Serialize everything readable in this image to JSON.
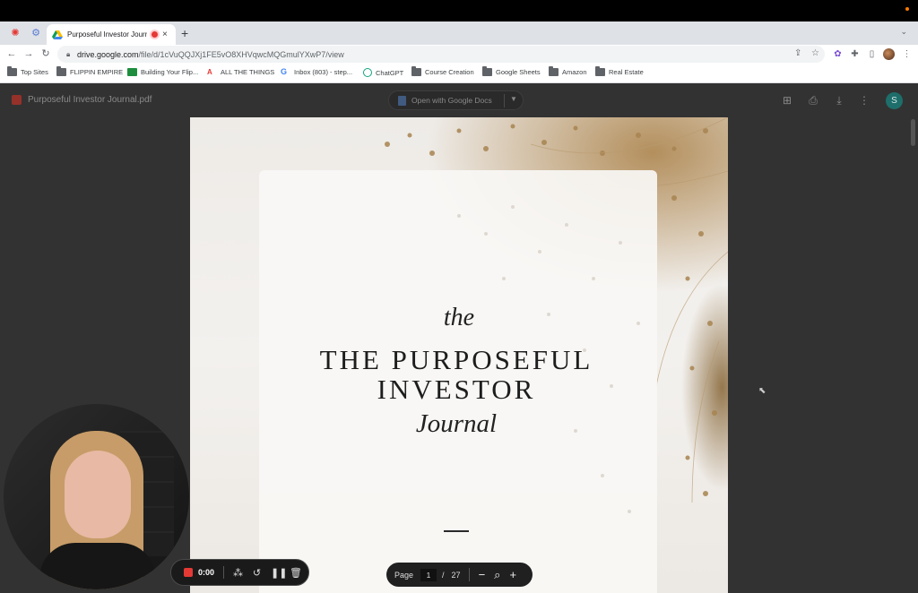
{
  "browser": {
    "tab": {
      "title": "Purposeful Investor Journ",
      "close": "×"
    },
    "new_tab": "+",
    "url": {
      "host": "drive.google.com",
      "path": "/file/d/1cVuQQJXj1FE5vO8XHVqwcMQGmulYXwP7/view"
    },
    "bookmarks": [
      {
        "label": "Top Sites",
        "icon": "folder-icon"
      },
      {
        "label": "FLIPPIN EMPIRE",
        "icon": "folder-icon"
      },
      {
        "label": "Building Your Flip...",
        "icon": "sheets-icon"
      },
      {
        "label": "ALL THE THINGS",
        "icon": "adobe-icon"
      },
      {
        "label": "Inbox (803) - step...",
        "icon": "google-icon"
      },
      {
        "label": "ChatGPT",
        "icon": "chatgpt-icon"
      },
      {
        "label": "Course Creation",
        "icon": "folder-icon"
      },
      {
        "label": "Google Sheets",
        "icon": "folder-icon"
      },
      {
        "label": "Amazon",
        "icon": "folder-icon"
      },
      {
        "label": "Real Estate",
        "icon": "folder-icon"
      }
    ]
  },
  "viewer": {
    "file_name": "Purposeful Investor Journal.pdf",
    "open_with": "Open with Google Docs",
    "avatar_letter": "S"
  },
  "document": {
    "title_small": "the",
    "title_line1": "THE PURPOSEFUL",
    "title_line2": "INVESTOR",
    "title_script": "Journal"
  },
  "page_controls": {
    "label": "Page",
    "current": "1",
    "separator": "/",
    "total": "27",
    "zoom_out": "−",
    "zoom_in": "+"
  },
  "recorder": {
    "time": "0:00"
  },
  "colors": {
    "record_red": "#e53935",
    "viewer_bg": "#323232",
    "avatar_teal": "#1e6e6b"
  }
}
